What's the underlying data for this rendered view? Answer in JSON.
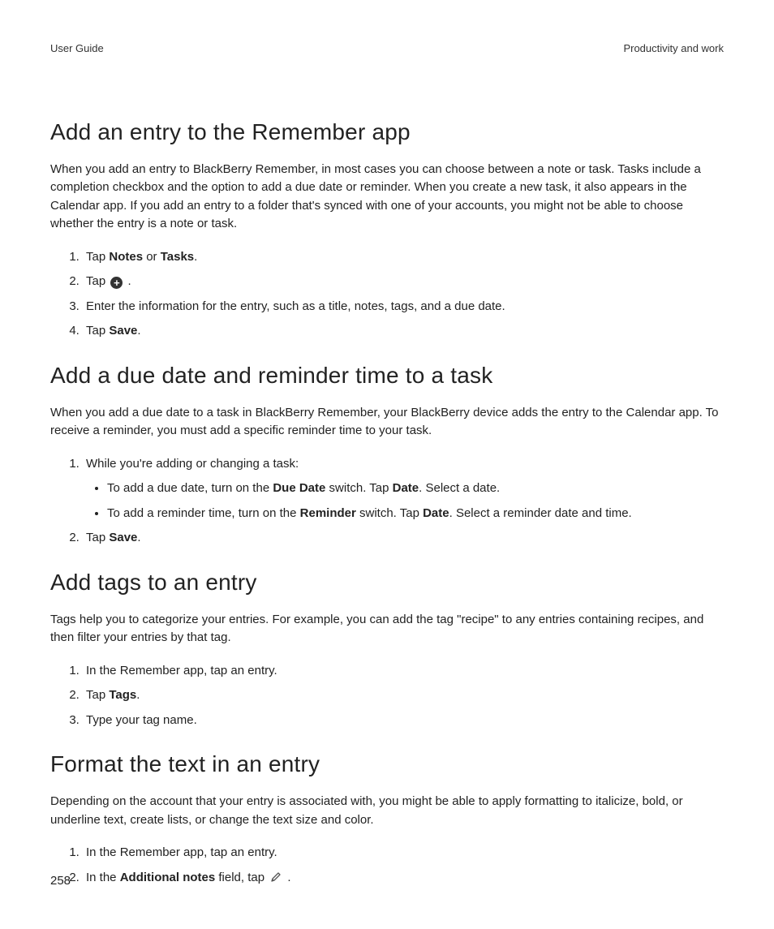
{
  "header": {
    "left": "User Guide",
    "right": "Productivity and work"
  },
  "page_number": "258",
  "s1": {
    "heading": "Add an entry to the Remember app",
    "para": "When you add an entry to BlackBerry Remember, in most cases you can choose between a note or task. Tasks include a completion checkbox and the option to add a due date or reminder. When you create a new task, it also appears in the Calendar app. If you add an entry to a folder that's synced with one of your accounts, you might not be able to choose whether the entry is a note or task.",
    "step1_a": "Tap ",
    "step1_b1": "Notes",
    "step1_c": " or ",
    "step1_b2": "Tasks",
    "step1_d": ".",
    "step2_a": "Tap ",
    "step2_b": " .",
    "step3": "Enter the information for the entry, such as a title, notes, tags, and a due date.",
    "step4_a": "Tap ",
    "step4_b": "Save",
    "step4_c": "."
  },
  "s2": {
    "heading": "Add a due date and reminder time to a task",
    "para": "When you add a due date to a task in BlackBerry Remember, your BlackBerry device adds the entry to the Calendar app. To receive a reminder, you must add a specific reminder time to your task.",
    "step1_intro": "While you're adding or changing a task:",
    "bullet1_a": "To add a due date, turn on the ",
    "bullet1_b": "Due Date",
    "bullet1_c": " switch. Tap ",
    "bullet1_d": "Date",
    "bullet1_e": ". Select a date.",
    "bullet2_a": "To add a reminder time, turn on the ",
    "bullet2_b": "Reminder",
    "bullet2_c": " switch. Tap ",
    "bullet2_d": "Date",
    "bullet2_e": ". Select a reminder date and time.",
    "step2_a": "Tap ",
    "step2_b": "Save",
    "step2_c": "."
  },
  "s3": {
    "heading": "Add tags to an entry",
    "para": "Tags help you to categorize your entries. For example, you can add the tag \"recipe\" to any entries containing recipes, and then filter your entries by that tag.",
    "step1": "In the Remember app, tap an entry.",
    "step2_a": "Tap ",
    "step2_b": "Tags",
    "step2_c": ".",
    "step3": "Type your tag name."
  },
  "s4": {
    "heading": "Format the text in an entry",
    "para": "Depending on the account that your entry is associated with, you might be able to apply formatting to italicize, bold, or underline text, create lists, or change the text size and color.",
    "step1": "In the Remember app, tap an entry.",
    "step2_a": "In the ",
    "step2_b": "Additional notes",
    "step2_c": " field, tap ",
    "step2_d": " ."
  },
  "icons": {
    "plus": "+",
    "pen": "pen"
  }
}
